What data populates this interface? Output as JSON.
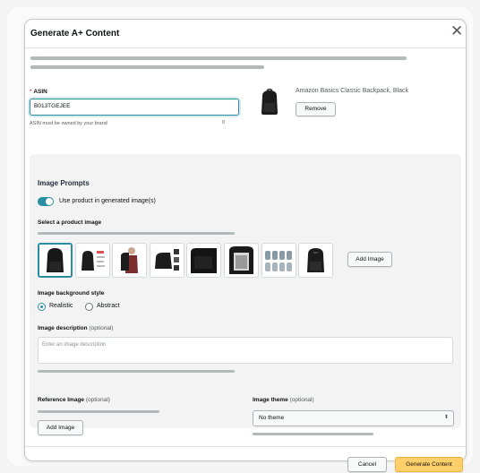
{
  "modal": {
    "title": "Generate A+ Content",
    "close_glyph": "✕"
  },
  "asin": {
    "label_required": "*",
    "label": "ASIN",
    "value": "B013TGEJEE",
    "hint": "ASIN must be owned by your brand",
    "char_count": "0"
  },
  "product": {
    "name": "Amazon Basics Classic Backpack, Black",
    "remove_label": "Remove"
  },
  "image_prompts": {
    "title": "Image Prompts",
    "toggle_label": "Use product in generated image(s)",
    "toggle_on": true,
    "select_label": "Select a product image",
    "thumbnails": [
      {
        "icon": "backpack-front-icon",
        "selected": true
      },
      {
        "icon": "backpack-features-icon",
        "selected": false
      },
      {
        "icon": "backpack-worn-icon",
        "selected": false
      },
      {
        "icon": "backpack-grid-icon",
        "selected": false
      },
      {
        "icon": "backpack-side-icon",
        "selected": false
      },
      {
        "icon": "backpack-interior-icon",
        "selected": false
      },
      {
        "icon": "backpack-variants-icon",
        "selected": false
      },
      {
        "icon": "backpack-angle-icon",
        "selected": false
      }
    ],
    "add_image_label": "Add Image",
    "background_style_label": "Image background style",
    "background_options": [
      {
        "label": "Realistic",
        "selected": true
      },
      {
        "label": "Abstract",
        "selected": false
      }
    ],
    "description_label": "Image description",
    "description_optional": "(optional)",
    "description_placeholder": "Enter an image description",
    "reference_label": "Reference Image",
    "reference_optional": "(optional)",
    "reference_add_label": "Add Image",
    "theme_label": "Image theme",
    "theme_optional": "(optional)",
    "theme_value": "No theme",
    "theme_caret": "⬍"
  },
  "footer": {
    "cancel_label": "Cancel",
    "generate_label": "Generate Content"
  },
  "colors": {
    "accent": "#2a8ea1",
    "primary_button": "#ffd06a",
    "panel": "#f3f3f3"
  }
}
